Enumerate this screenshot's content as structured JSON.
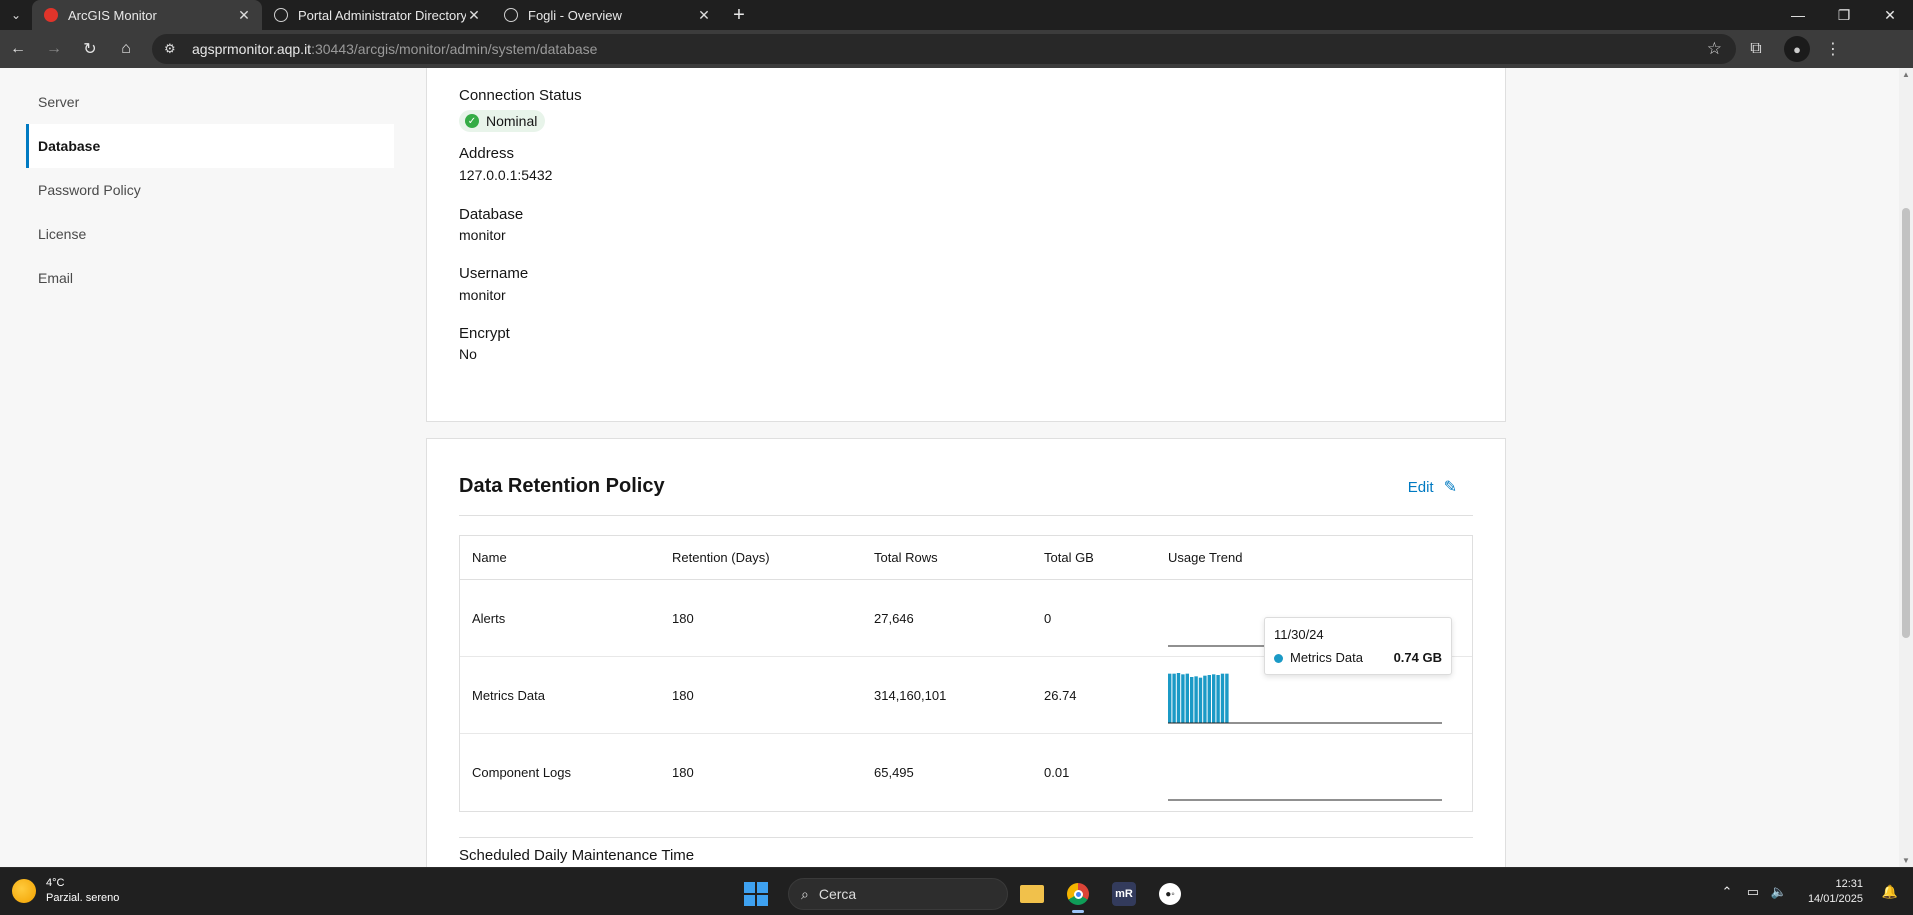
{
  "browser": {
    "tabs": [
      {
        "title": "ArcGIS Monitor",
        "active": true
      },
      {
        "title": "Portal Administrator Directory",
        "active": false
      },
      {
        "title": "Fogli - Overview",
        "active": false
      }
    ],
    "url_host": "agsprmonitor.aqp.it",
    "url_path": ":30443/arcgis/monitor/admin/system/database"
  },
  "sidebar": {
    "items": [
      {
        "label": "Server",
        "active": false
      },
      {
        "label": "Database",
        "active": true
      },
      {
        "label": "Password Policy",
        "active": false
      },
      {
        "label": "License",
        "active": false
      },
      {
        "label": "Email",
        "active": false
      }
    ]
  },
  "connection": {
    "status_label": "Connection Status",
    "status_value": "Nominal",
    "address_label": "Address",
    "address_value": "127.0.0.1:5432",
    "database_label": "Database",
    "database_value": "monitor",
    "username_label": "Username",
    "username_value": "monitor",
    "encrypt_label": "Encrypt",
    "encrypt_value": "No"
  },
  "retention": {
    "title": "Data Retention Policy",
    "edit_label": "Edit",
    "columns": [
      "Name",
      "Retention (Days)",
      "Total Rows",
      "Total GB",
      "Usage Trend"
    ],
    "rows": [
      {
        "name": "Alerts",
        "retention": "180",
        "rows": "27,646",
        "gb": "0",
        "trend": []
      },
      {
        "name": "Metrics Data",
        "retention": "180",
        "rows": "314,160,101",
        "gb": "26.74",
        "trend": [
          0.74,
          0.74,
          0.75,
          0.73,
          0.74,
          0.69,
          0.7,
          0.68,
          0.71,
          0.72,
          0.73,
          0.72,
          0.74,
          0.74
        ]
      },
      {
        "name": "Component Logs",
        "retention": "180",
        "rows": "65,495",
        "gb": "0.01",
        "trend": []
      }
    ],
    "tooltip": {
      "date": "11/30/24",
      "series": "Metrics Data",
      "value": "0.74 GB"
    },
    "maintenance_title": "Scheduled Daily Maintenance Time"
  },
  "colors": {
    "accent": "#007ac2",
    "trend": "#1b9ac6",
    "ok": "#35ac46"
  },
  "taskbar": {
    "temperature": "4°C",
    "weather": "Parzial. sereno",
    "search_placeholder": "Cerca",
    "time": "12:31",
    "date": "14/01/2025"
  }
}
